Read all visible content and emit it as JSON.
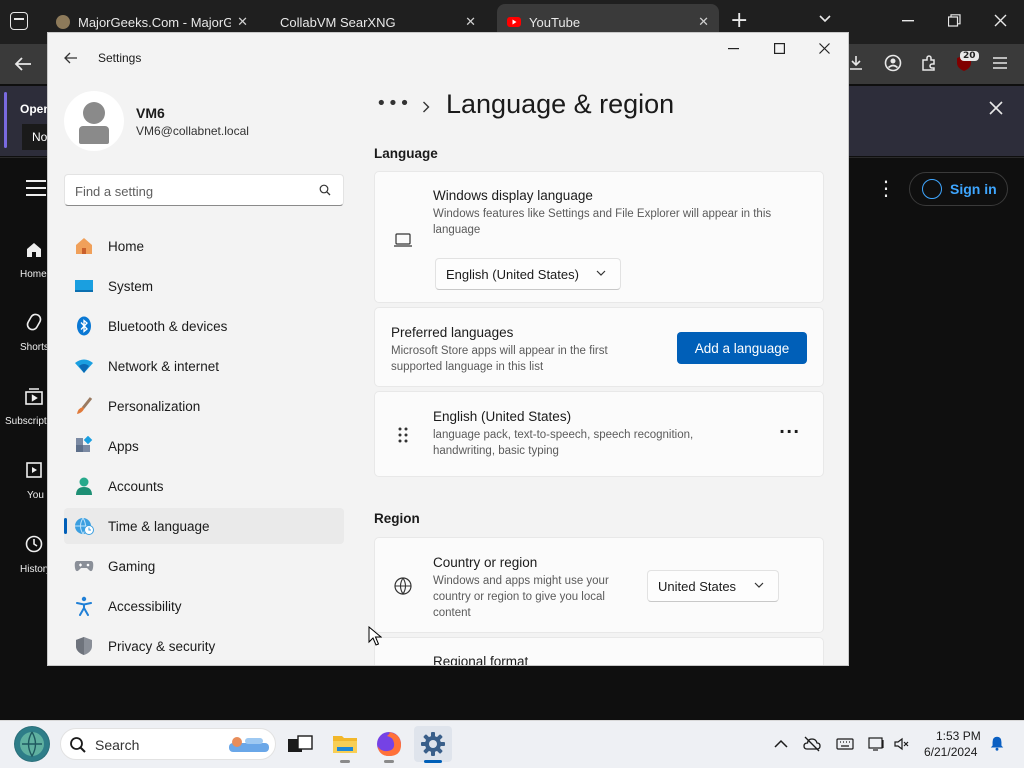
{
  "browser": {
    "tabs": [
      {
        "label": "MajorGeeks.Com - MajorGeeks",
        "close": "✕"
      },
      {
        "label": "CollabVM SearXNG",
        "close": "✕"
      },
      {
        "label": "YouTube",
        "close": "✕"
      }
    ],
    "new_tab": "+",
    "extension_badge": "20",
    "notification": {
      "open_text": "Open",
      "no_text": "No"
    }
  },
  "youtube": {
    "sidebar": [
      "Home",
      "Shorts",
      "Subscriptions",
      "You",
      "History"
    ],
    "sign_in": "Sign in"
  },
  "settings": {
    "title": "Settings",
    "user": {
      "name": "VM6",
      "email": "VM6@collabnet.local"
    },
    "search_placeholder": "Find a setting",
    "nav": [
      {
        "label": "Home",
        "icon": "home-icon"
      },
      {
        "label": "System",
        "icon": "system-icon"
      },
      {
        "label": "Bluetooth & devices",
        "icon": "bluetooth-icon"
      },
      {
        "label": "Network & internet",
        "icon": "wifi-icon"
      },
      {
        "label": "Personalization",
        "icon": "brush-icon"
      },
      {
        "label": "Apps",
        "icon": "apps-icon"
      },
      {
        "label": "Accounts",
        "icon": "accounts-icon"
      },
      {
        "label": "Time & language",
        "icon": "globe-clock-icon",
        "selected": true
      },
      {
        "label": "Gaming",
        "icon": "gamepad-icon"
      },
      {
        "label": "Accessibility",
        "icon": "accessibility-icon"
      },
      {
        "label": "Privacy & security",
        "icon": "shield-icon"
      }
    ],
    "breadcrumb_more": "•••",
    "page_title": "Language & region",
    "language_section": "Language",
    "display_language": {
      "title": "Windows display language",
      "desc": "Windows features like Settings and File Explorer will appear in this language",
      "value": "English (United States)"
    },
    "preferred_languages": {
      "title": "Preferred languages",
      "desc": "Microsoft Store apps will appear in the first supported language in this list",
      "button": "Add a language"
    },
    "installed_language": {
      "title": "English (United States)",
      "desc": "language pack, text-to-speech, speech recognition, handwriting, basic typing"
    },
    "region_section": "Region",
    "country": {
      "title": "Country or region",
      "desc": "Windows and apps might use your country or region to give you local content",
      "value": "United States"
    },
    "regional_format": {
      "title": "Regional format"
    }
  },
  "taskbar": {
    "search_label": "Search",
    "time": "1:53 PM",
    "date": "6/21/2024"
  },
  "colors": {
    "accent": "#005fb8",
    "youtube_blue": "#3ea6ff"
  }
}
